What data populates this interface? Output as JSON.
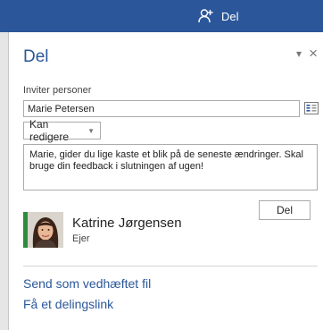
{
  "titlebar": {
    "share_button_label": "Del"
  },
  "pane": {
    "title": "Del",
    "invite_label": "Inviter personer",
    "invite_value": "Marie Petersen",
    "permission_selected": "Kan redigere",
    "message_text": "Marie, gider du lige kaste et blik på de seneste ændringer. Skal bruge din feedback i slutningen af ugen!",
    "send_button_label": "Del",
    "shared_with": [
      {
        "name": "Katrine Jørgensen",
        "role": "Ejer"
      }
    ],
    "links": {
      "send_attachment": "Send som vedhæftet fil",
      "get_link": "Få et delingslink"
    }
  },
  "colors": {
    "brand": "#2b579a",
    "owner_accent": "#2e8b3e"
  },
  "icons": {
    "share": "add-person-icon",
    "address_book": "address-book-icon",
    "collapse": "chevron-down-icon",
    "close": "close-icon"
  }
}
